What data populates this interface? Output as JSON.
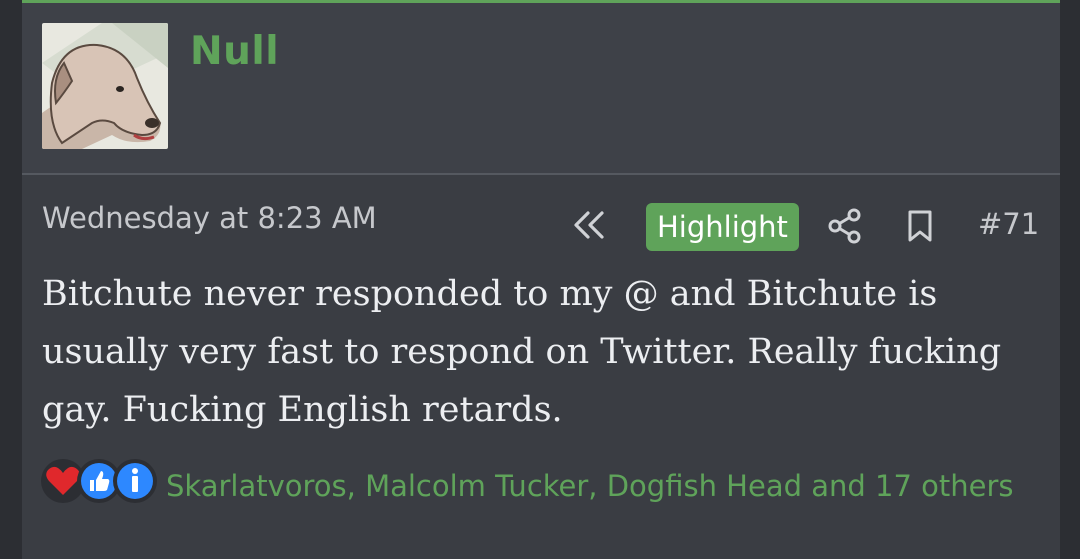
{
  "post": {
    "username": "Null",
    "date": "Wednesday at 8:23 AM",
    "highlight_label": "Highlight",
    "post_number": "#71",
    "message": "Bitchute never responded to my @ and Bitchute is usually very fast to respond on Twitter. Really fucking gay. Fucking English retards.",
    "reactions": {
      "icons": [
        "heart-icon",
        "thumbs-up-icon",
        "info-icon"
      ],
      "text": "Skarlatvoros, Malcolm Tucker, Dogfish Head and 17 others"
    }
  },
  "colors": {
    "accent": "#5fa35a",
    "panel": "#3a3d43",
    "text": "#eceef1"
  }
}
